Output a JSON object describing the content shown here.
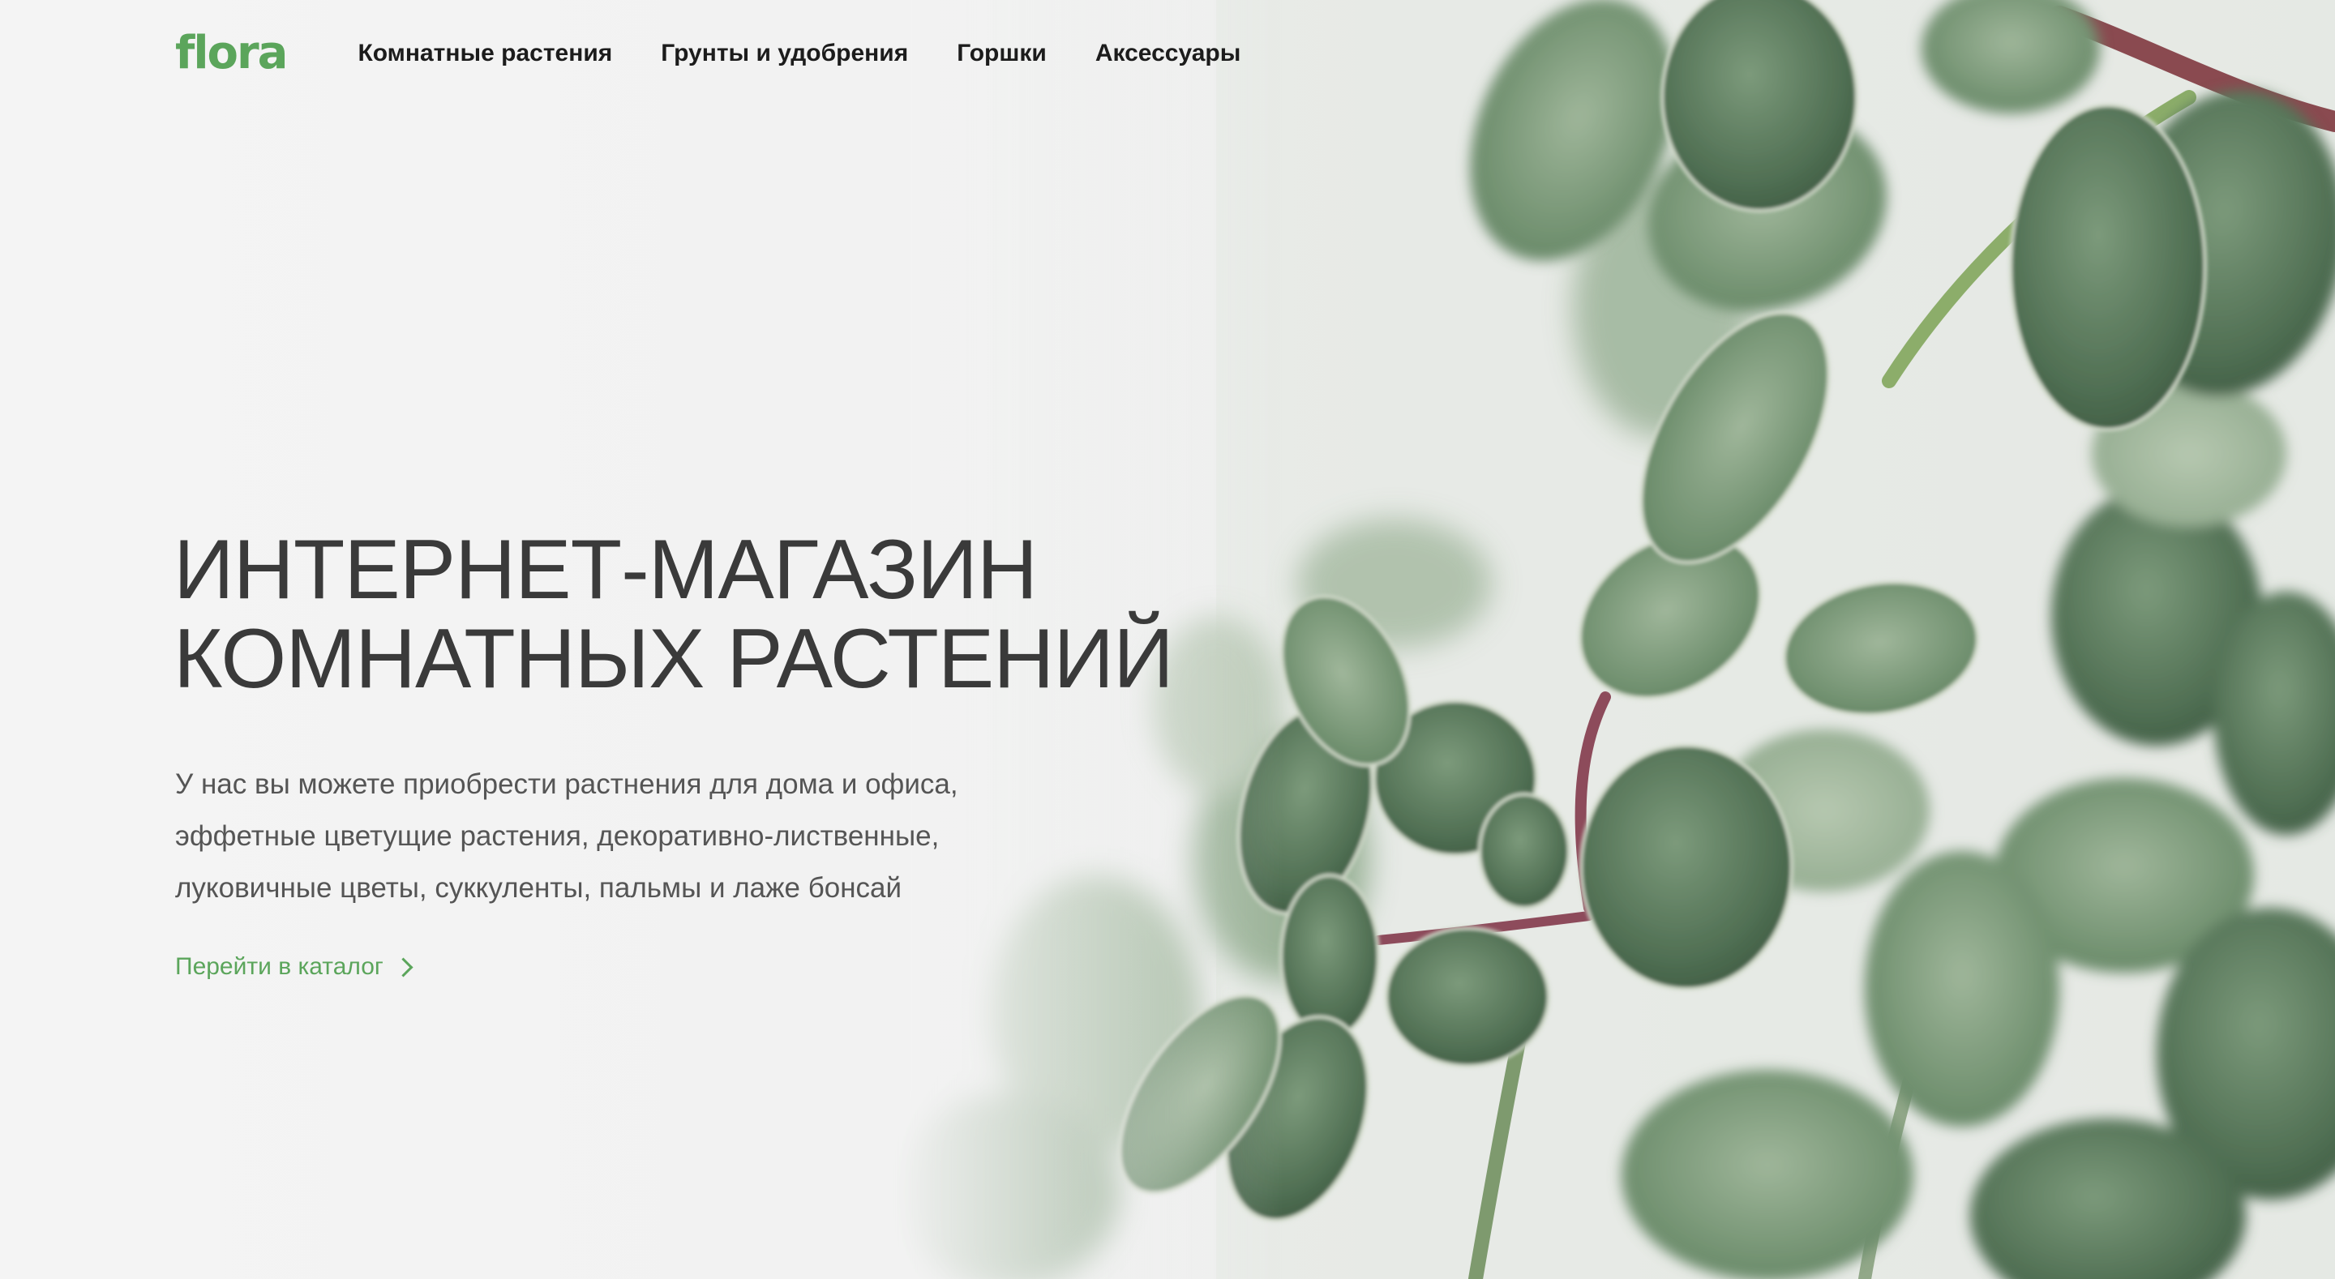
{
  "brand": {
    "logo_text": "flora",
    "accent_color": "#5ba55b"
  },
  "nav": {
    "items": [
      {
        "label": "Комнатные растения"
      },
      {
        "label": "Грунты и удобрения"
      },
      {
        "label": "Горшки"
      },
      {
        "label": "Аксессуары"
      }
    ]
  },
  "hero": {
    "title_lines": [
      "ИНТЕРНЕТ-МАГАЗИН",
      "КОМНАТНЫХ РАСТЕНИЙ"
    ],
    "description_lines": [
      "У нас вы можете приобрести растнения для дома и офиса,",
      "эффетные цветущие растения, декоративно-лиственные,",
      "луковичные цветы, суккуленты, пальмы и лаже бонсай"
    ],
    "cta_label": "Перейти в каталог",
    "cta_icon": "chevron-right-icon",
    "background_image": "succulent-plant-photo"
  }
}
